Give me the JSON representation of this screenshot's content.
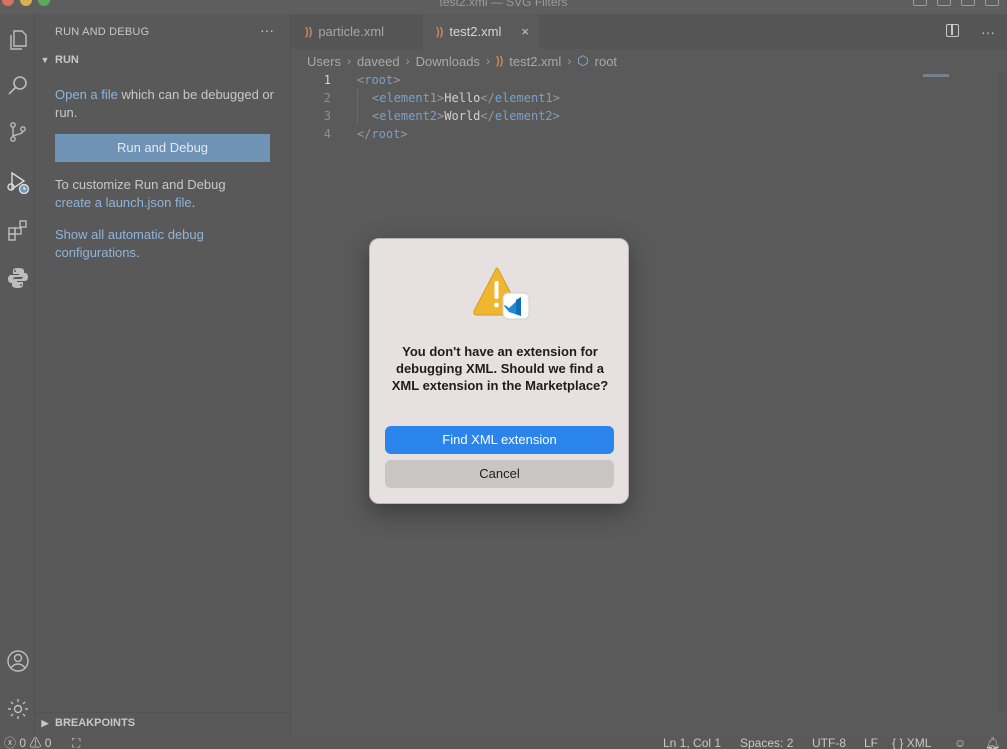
{
  "window": {
    "title": "test2.xml — SVG Filters"
  },
  "activity_bar": {
    "icons": [
      "explorer-icon",
      "search-icon",
      "source-control-icon",
      "run-debug-icon",
      "extensions-icon",
      "python-icon",
      "account-icon",
      "settings-gear-icon"
    ]
  },
  "sidebar": {
    "header": "RUN AND DEBUG",
    "more": "···",
    "run_section": "RUN",
    "open_link": "Open a file",
    "open_rest": " which can be debugged or run.",
    "run_button": "Run and Debug",
    "customize_text": "To customize Run and Debug",
    "launch_link": "create a launch.json file",
    "launch_end": ".",
    "show_link": "Show all automatic debug configurations",
    "show_end": ".",
    "breakpoints_section": "BREAKPOINTS"
  },
  "tabs": [
    {
      "label": "particle.xml",
      "active": false
    },
    {
      "label": "test2.xml",
      "active": true,
      "close": "×"
    }
  ],
  "breadcrumb": [
    "Users",
    "daveed",
    "Downloads",
    "test2.xml",
    "root"
  ],
  "code": {
    "line_numbers": [
      "1",
      "2",
      "3",
      "4"
    ],
    "line1": {
      "open": "<",
      "tag": "root",
      "close": ">"
    },
    "line2": {
      "open": "<",
      "tag": "element1",
      "close": ">",
      "text": "Hello",
      "end_open": "</",
      "end_tag": "element1",
      "end_close": ">"
    },
    "line3": {
      "open": "<",
      "tag": "element2",
      "close": ">",
      "text": "World",
      "end_open": "</",
      "end_tag": "element2",
      "end_close": ">"
    },
    "line4": {
      "open": "</",
      "tag": "root",
      "close": ">"
    }
  },
  "dialog": {
    "message": "You don't have an extension for debugging XML. Should we find a XML extension in the Marketplace?",
    "primary_button": "Find XML extension",
    "secondary_button": "Cancel"
  },
  "status_bar": {
    "errors": "0",
    "warnings": "0",
    "position": "Ln 1, Col 1",
    "spaces": "Spaces: 2",
    "encoding": "UTF-8",
    "eol": "LF",
    "language_braces": "{ }",
    "language": "XML"
  },
  "colors": {
    "accent_link": "#8fb4d8",
    "dialog_primary": "#2b84ea",
    "xml_tag": "#7aa0c8"
  }
}
